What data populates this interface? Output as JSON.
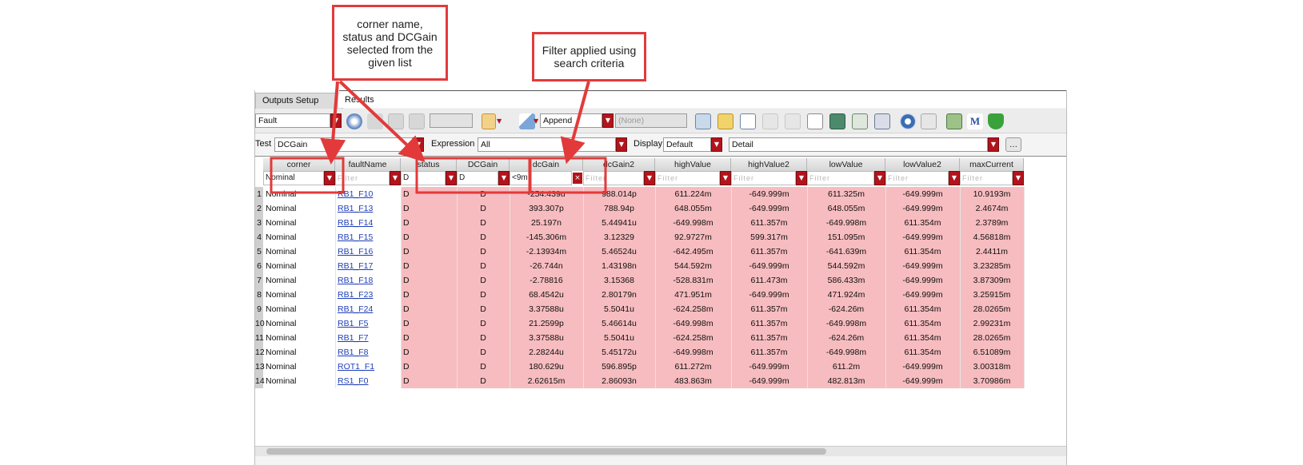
{
  "callouts": {
    "selected_columns": [
      "corner name,",
      "status and DCGain",
      "selected from the",
      "given list"
    ],
    "filter_applied": [
      "Filter applied using",
      "search criteria"
    ]
  },
  "tabs": [
    {
      "label": "Outputs Setup"
    },
    {
      "label": "Results"
    }
  ],
  "toolbar": {
    "view_value": "Fault",
    "mode_value": "Append",
    "history_value": "(None)"
  },
  "filters": {
    "test_label": "Test",
    "test_value": "DCGain",
    "expression_label": "Expression",
    "expression_value": "All",
    "display_label": "Display",
    "display_value": "Default",
    "detail_value": "Detail"
  },
  "table": {
    "columns": [
      "corner",
      "faultName",
      "status",
      "DCGain",
      "dcGain",
      "dcGain2",
      "highValue",
      "highValue2",
      "lowValue",
      "lowValue2",
      "maxCurrent"
    ],
    "filter_row": {
      "corner": "Nominal",
      "status": "D",
      "DCGain": "D",
      "dcGain": "<9m",
      "placeholder": "Filter"
    },
    "rows": [
      {
        "n": "1",
        "corner": "Nominal",
        "fault": "RB1_F10",
        "status": "D",
        "DCGain": "D",
        "dcGain": "-254.439u",
        "dcGain2": "988.014p",
        "highValue": "611.224m",
        "highValue2": "-649.999m",
        "lowValue": "611.325m",
        "lowValue2": "-649.999m",
        "maxCurrent": "10.9193m"
      },
      {
        "n": "2",
        "corner": "Nominal",
        "fault": "RB1_F13",
        "status": "D",
        "DCGain": "D",
        "dcGain": "393.307p",
        "dcGain2": "788.94p",
        "highValue": "648.055m",
        "highValue2": "-649.999m",
        "lowValue": "648.055m",
        "lowValue2": "-649.999m",
        "maxCurrent": "2.4674m"
      },
      {
        "n": "3",
        "corner": "Nominal",
        "fault": "RB1_F14",
        "status": "D",
        "DCGain": "D",
        "dcGain": "25.197n",
        "dcGain2": "5.44941u",
        "highValue": "-649.998m",
        "highValue2": "611.357m",
        "lowValue": "-649.998m",
        "lowValue2": "611.354m",
        "maxCurrent": "2.3789m"
      },
      {
        "n": "4",
        "corner": "Nominal",
        "fault": "RB1_F15",
        "status": "D",
        "DCGain": "D",
        "dcGain": "-145.306m",
        "dcGain2": "3.12329",
        "highValue": "92.9727m",
        "highValue2": "599.317m",
        "lowValue": "151.095m",
        "lowValue2": "-649.999m",
        "maxCurrent": "4.56818m"
      },
      {
        "n": "5",
        "corner": "Nominal",
        "fault": "RB1_F16",
        "status": "D",
        "DCGain": "D",
        "dcGain": "-2.13934m",
        "dcGain2": "5.46524u",
        "highValue": "-642.495m",
        "highValue2": "611.357m",
        "lowValue": "-641.639m",
        "lowValue2": "611.354m",
        "maxCurrent": "2.4411m"
      },
      {
        "n": "6",
        "corner": "Nominal",
        "fault": "RB1_F17",
        "status": "D",
        "DCGain": "D",
        "dcGain": "-26.744n",
        "dcGain2": "1.43198n",
        "highValue": "544.592m",
        "highValue2": "-649.999m",
        "lowValue": "544.592m",
        "lowValue2": "-649.999m",
        "maxCurrent": "3.23285m"
      },
      {
        "n": "7",
        "corner": "Nominal",
        "fault": "RB1_F18",
        "status": "D",
        "DCGain": "D",
        "dcGain": "-2.78816",
        "dcGain2": "3.15368",
        "highValue": "-528.831m",
        "highValue2": "611.473m",
        "lowValue": "586.433m",
        "lowValue2": "-649.999m",
        "maxCurrent": "3.87309m"
      },
      {
        "n": "8",
        "corner": "Nominal",
        "fault": "RB1_F23",
        "status": "D",
        "DCGain": "D",
        "dcGain": "68.4542u",
        "dcGain2": "2.80179n",
        "highValue": "471.951m",
        "highValue2": "-649.999m",
        "lowValue": "471.924m",
        "lowValue2": "-649.999m",
        "maxCurrent": "3.25915m"
      },
      {
        "n": "9",
        "corner": "Nominal",
        "fault": "RB1_F24",
        "status": "D",
        "DCGain": "D",
        "dcGain": "3.37588u",
        "dcGain2": "5.5041u",
        "highValue": "-624.258m",
        "highValue2": "611.357m",
        "lowValue": "-624.26m",
        "lowValue2": "611.354m",
        "maxCurrent": "28.0265m"
      },
      {
        "n": "10",
        "corner": "Nominal",
        "fault": "RB1_F5",
        "status": "D",
        "DCGain": "D",
        "dcGain": "21.2599p",
        "dcGain2": "5.46614u",
        "highValue": "-649.998m",
        "highValue2": "611.357m",
        "lowValue": "-649.998m",
        "lowValue2": "611.354m",
        "maxCurrent": "2.99231m"
      },
      {
        "n": "11",
        "corner": "Nominal",
        "fault": "RB1_F7",
        "status": "D",
        "DCGain": "D",
        "dcGain": "3.37588u",
        "dcGain2": "5.5041u",
        "highValue": "-624.258m",
        "highValue2": "611.357m",
        "lowValue": "-624.26m",
        "lowValue2": "611.354m",
        "maxCurrent": "28.0265m"
      },
      {
        "n": "12",
        "corner": "Nominal",
        "fault": "RB1_F8",
        "status": "D",
        "DCGain": "D",
        "dcGain": "2.28244u",
        "dcGain2": "5.45172u",
        "highValue": "-649.998m",
        "highValue2": "611.357m",
        "lowValue": "-649.998m",
        "lowValue2": "611.354m",
        "maxCurrent": "6.51089m"
      },
      {
        "n": "13",
        "corner": "Nominal",
        "fault": "ROT1_F1",
        "status": "D",
        "DCGain": "D",
        "dcGain": "180.629u",
        "dcGain2": "596.895p",
        "highValue": "611.272m",
        "highValue2": "-649.999m",
        "lowValue": "611.2m",
        "lowValue2": "-649.999m",
        "maxCurrent": "3.00318m"
      },
      {
        "n": "14",
        "corner": "Nominal",
        "fault": "RS1_F0",
        "status": "D",
        "DCGain": "D",
        "dcGain": "2.62615m",
        "dcGain2": "2.86093n",
        "highValue": "483.863m",
        "highValue2": "-649.999m",
        "lowValue": "482.813m",
        "lowValue2": "-649.999m",
        "maxCurrent": "3.70986m"
      }
    ]
  },
  "colors": {
    "accent": "#b3141c",
    "callout": "#e23a3a",
    "fault_row": "#f7bcbf",
    "link": "#1f3fb8"
  }
}
